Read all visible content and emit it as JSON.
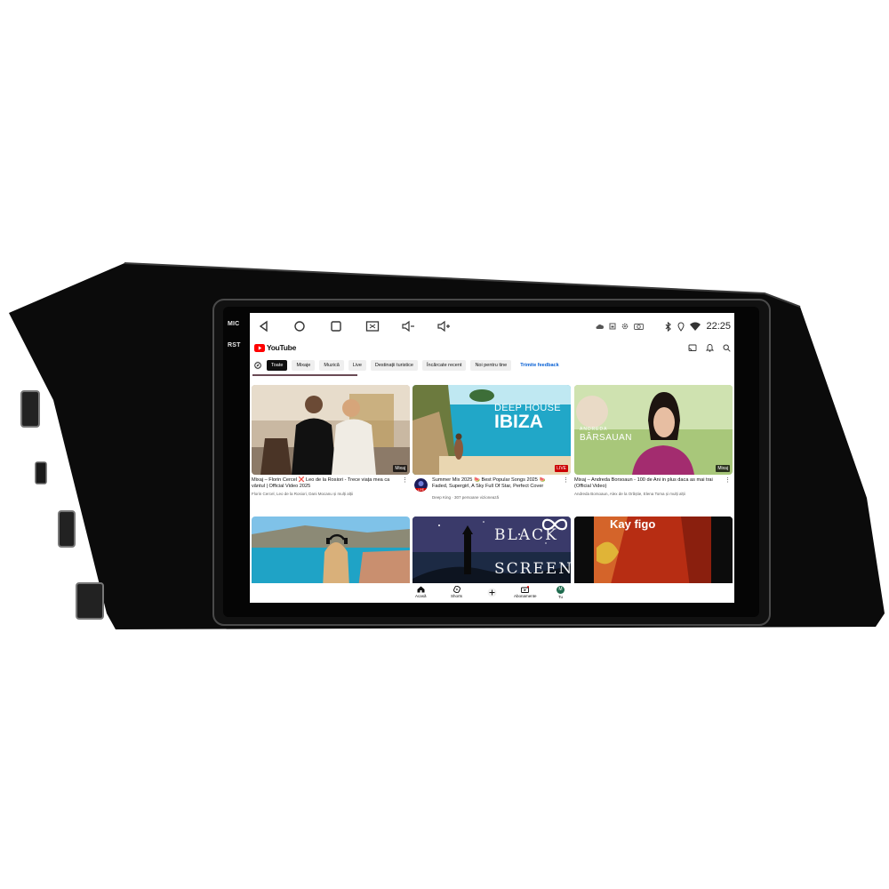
{
  "hardware": {
    "mic_label": "MIC",
    "rst_label": "RST"
  },
  "status_bar": {
    "time": "22:25"
  },
  "youtube": {
    "logo_text": "YouTube",
    "chips": [
      "Toate",
      "Mixaje",
      "Muzică",
      "Live",
      "Destinații turistice",
      "Încărcate recent",
      "Noi pentru tine"
    ],
    "feedback_link": "Trimite feedback"
  },
  "videos": [
    {
      "title": "Mixaj – Florin Cercel ❌ Leo de la Rosiori - Trece viața mea ca vântul | Official Video 2025",
      "meta": "Florin Cercel, Leo de la Rosiori, Dani Mocanu și mulți alții",
      "badge": "Mixaj"
    },
    {
      "title": "Summer Mix 2025 🍉 Best Popular Songs 2025 🍉 Faded, Supergirl, A Sky Full Of Star, Perfect Cover",
      "meta": "Deep King · 307 persoane vizionează",
      "badge": "LIVE",
      "thumb_line1": "DEEP HOUSE",
      "thumb_line2": "IBIZA",
      "avatar_text": "LIVE"
    },
    {
      "title": "Mixaj – Andreda Borsoaun - 100 de Ani in plus daca as mai trai (Official Video)",
      "meta": "Andreda Borsoaun, Alex de la Orăștie, Elena Toma și mulți alții",
      "badge": "Mixaj",
      "thumb_line1": "ANDREDA",
      "thumb_line2": "BÂRSAUAN"
    },
    {
      "title": ""
    },
    {
      "title": "",
      "thumb_line1": "BLACK",
      "thumb_line2": "SCREEN"
    },
    {
      "title": "",
      "thumb_line1": "Kay figo"
    }
  ],
  "bottom_nav": [
    {
      "label": "Acasă"
    },
    {
      "label": "Shorts"
    },
    {
      "label": ""
    },
    {
      "label": "Abonamente"
    },
    {
      "label": "Tu",
      "avatar": "M"
    }
  ],
  "colors": {
    "youtube_red": "#ff0000",
    "live_red": "#cc0000",
    "link_blue": "#065fd4"
  }
}
